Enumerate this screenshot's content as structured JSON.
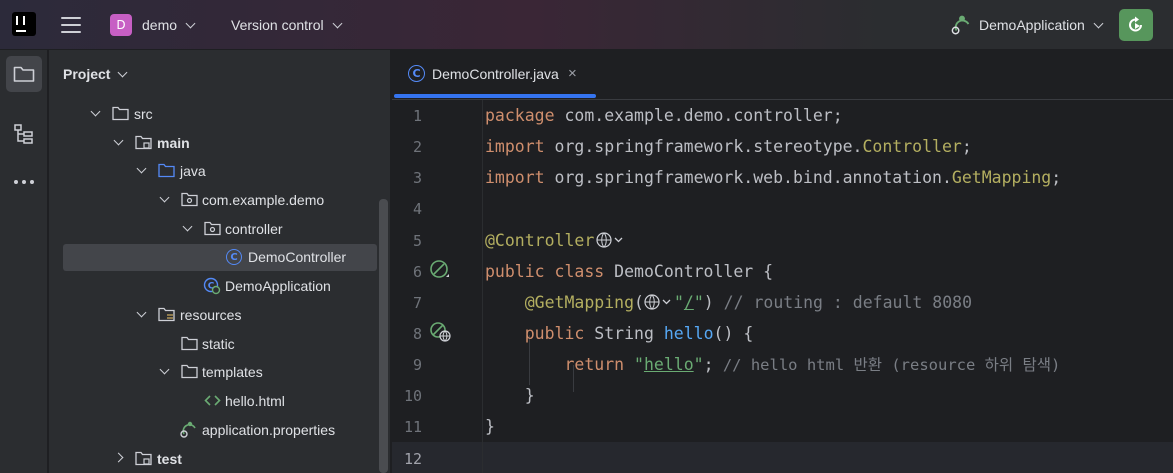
{
  "titlebar": {
    "project_letter": "D",
    "project_name": "demo",
    "vcs_label": "Version control",
    "run_config": "DemoApplication"
  },
  "project_panel": {
    "header": "Project",
    "tree": [
      {
        "label": "src",
        "bold": false
      },
      {
        "label": "main",
        "bold": true
      },
      {
        "label": "java",
        "bold": false
      },
      {
        "label": "com.example.demo",
        "bold": false
      },
      {
        "label": "controller",
        "bold": false
      },
      {
        "label": "DemoController",
        "bold": false,
        "selected": true
      },
      {
        "label": "DemoApplication",
        "bold": false
      },
      {
        "label": "resources",
        "bold": false
      },
      {
        "label": "static",
        "bold": false
      },
      {
        "label": "templates",
        "bold": false
      },
      {
        "label": "hello.html",
        "bold": false
      },
      {
        "label": "application.properties",
        "bold": false
      },
      {
        "label": "test",
        "bold": true
      }
    ]
  },
  "editor": {
    "tab": {
      "icon_letter": "C",
      "label": "DemoController.java",
      "close": "×"
    },
    "line_numbers": [
      "1",
      "2",
      "3",
      "4",
      "5",
      "6",
      "7",
      "8",
      "9",
      "10",
      "11",
      "12"
    ],
    "code": {
      "l1_kw": "package",
      "l1_rest": " com.example.demo.controller;",
      "l2_kw": "import",
      "l2_rest": " org.springframework.stereotype.",
      "l2_cls": "Controller",
      "l2_end": ";",
      "l3_kw": "import",
      "l3_rest": " org.springframework.web.bind.annotation.",
      "l3_cls": "GetMapping",
      "l3_end": ";",
      "l5_ann": "@Controller",
      "l6_kw": "public class",
      "l6_rest": " DemoController {",
      "l7_ann": "@GetMapping",
      "l7_open": "(",
      "l7_str1": "\"",
      "l7_str2": "/",
      "l7_str3": "\"",
      "l7_close": ")",
      "l7_cmt": " // routing : default 8080",
      "l8_kw": "public",
      "l8_mid": " String ",
      "l8_fn": "hello",
      "l8_rest": "() {",
      "l9_kw": "return",
      "l9_str1": " \"",
      "l9_str2": "hello",
      "l9_str3": "\"",
      "l9_semi": ";",
      "l9_cmt": " // hello html 반환 (resource 하위 탐색)",
      "l10": "}",
      "l11": "}"
    }
  },
  "colors": {
    "accent": "#3574f0",
    "run_green": "#57965c",
    "project_badge": "#c75fc4"
  }
}
